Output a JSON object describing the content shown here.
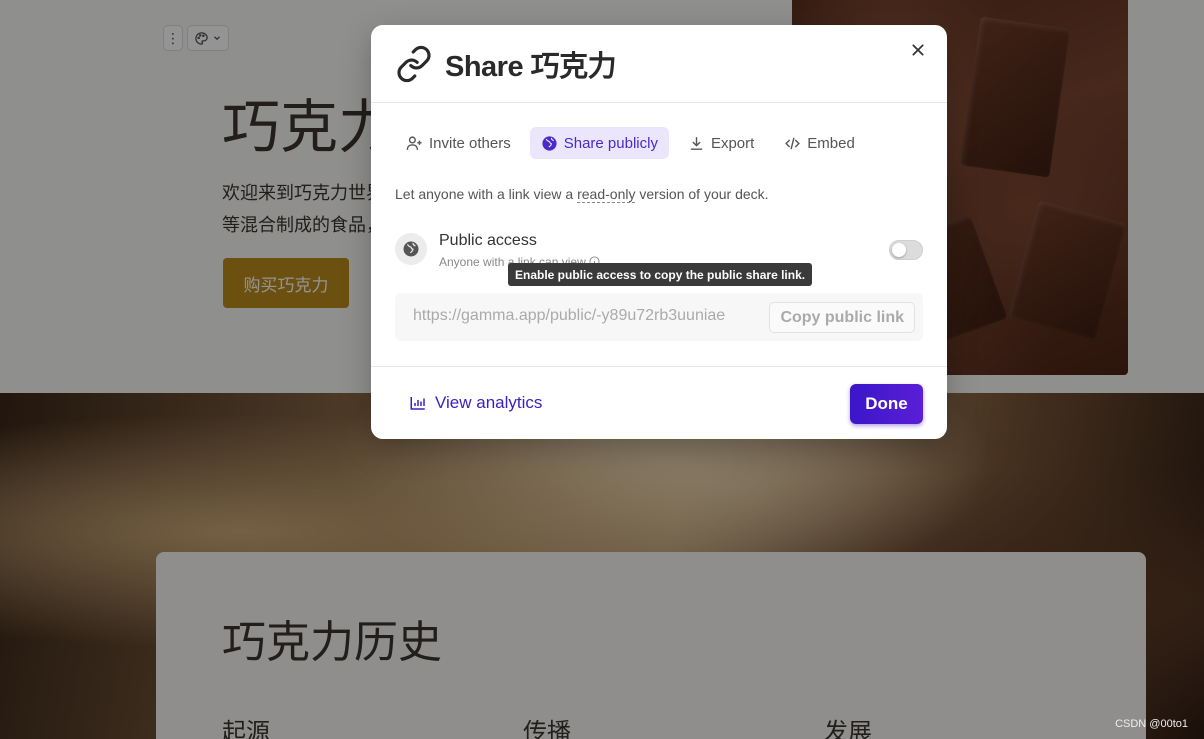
{
  "deck": {
    "hero_title": "巧克力",
    "hero_text_line1": "欢迎来到巧克力世界",
    "hero_text_line2": "等混合制成的食品，",
    "buy_button": "购买巧克力",
    "history_title": "巧克力历史",
    "history_cols": [
      "起源",
      "传播",
      "发展"
    ]
  },
  "modal": {
    "title": "Share 巧克力",
    "tabs": [
      {
        "label": "Invite others",
        "icon": "user-plus-icon",
        "active": false
      },
      {
        "label": "Share publicly",
        "icon": "globe-icon",
        "active": true
      },
      {
        "label": "Export",
        "icon": "download-icon",
        "active": false
      },
      {
        "label": "Embed",
        "icon": "code-icon",
        "active": false
      }
    ],
    "description_prefix": "Let anyone with a link view a ",
    "description_emphasis": "read-only",
    "description_suffix": " version of your deck.",
    "public_access": {
      "title": "Public access",
      "subtitle": "Anyone with a link can view",
      "enabled": false
    },
    "tooltip": "Enable public access to copy the public share link.",
    "public_link": "https://gamma.app/public/-y89u72rb3uuniae",
    "copy_button": "Copy public link",
    "view_analytics": "View analytics",
    "done_button": "Done"
  },
  "watermark": "CSDN @00to1",
  "colors": {
    "accent": "#4a2bc9",
    "done_button": "#3b16c9",
    "active_tab_bg": "#ebe6fb",
    "buy_button": "#b88a1b"
  }
}
